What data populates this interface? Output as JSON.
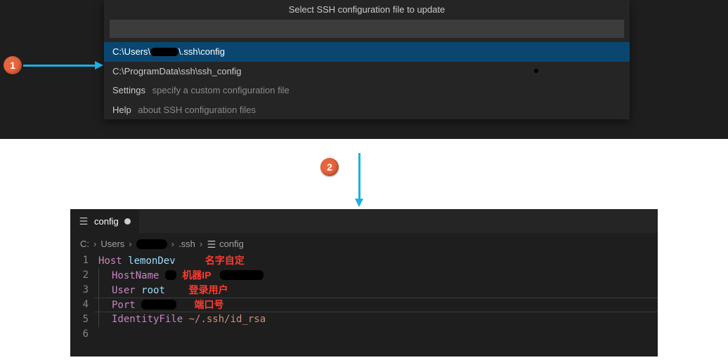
{
  "picker": {
    "title": "Select SSH configuration file to update",
    "input_value": "",
    "items": [
      {
        "pre": "C:\\Users\\",
        "post": "\\.ssh\\config",
        "selected": true
      },
      {
        "label": "C:\\ProgramData\\ssh\\ssh_config",
        "has_dot": true
      },
      {
        "label": "Settings",
        "desc": "specify a custom configuration file"
      },
      {
        "label": "Help",
        "desc": "about SSH configuration files"
      }
    ]
  },
  "steps": {
    "s1": "1",
    "s2": "2"
  },
  "editor": {
    "tab_label": "config",
    "breadcrumb": {
      "p0": "C:",
      "p1": "Users",
      "p2": ".ssh",
      "p3": "config"
    },
    "gutter": [
      "1",
      "2",
      "3",
      "4",
      "5",
      "6"
    ],
    "line1": {
      "kw": "Host",
      "val": "lemonDev",
      "anno": "名字自定"
    },
    "line2": {
      "kw": "HostName",
      "anno": "机器IP"
    },
    "line3": {
      "kw": "User",
      "val": "root",
      "anno": "登录用户"
    },
    "line4": {
      "kw": "Port",
      "anno": "端口号"
    },
    "line5": {
      "kw": "IdentityFile",
      "val": "~/.ssh/id_rsa"
    }
  }
}
